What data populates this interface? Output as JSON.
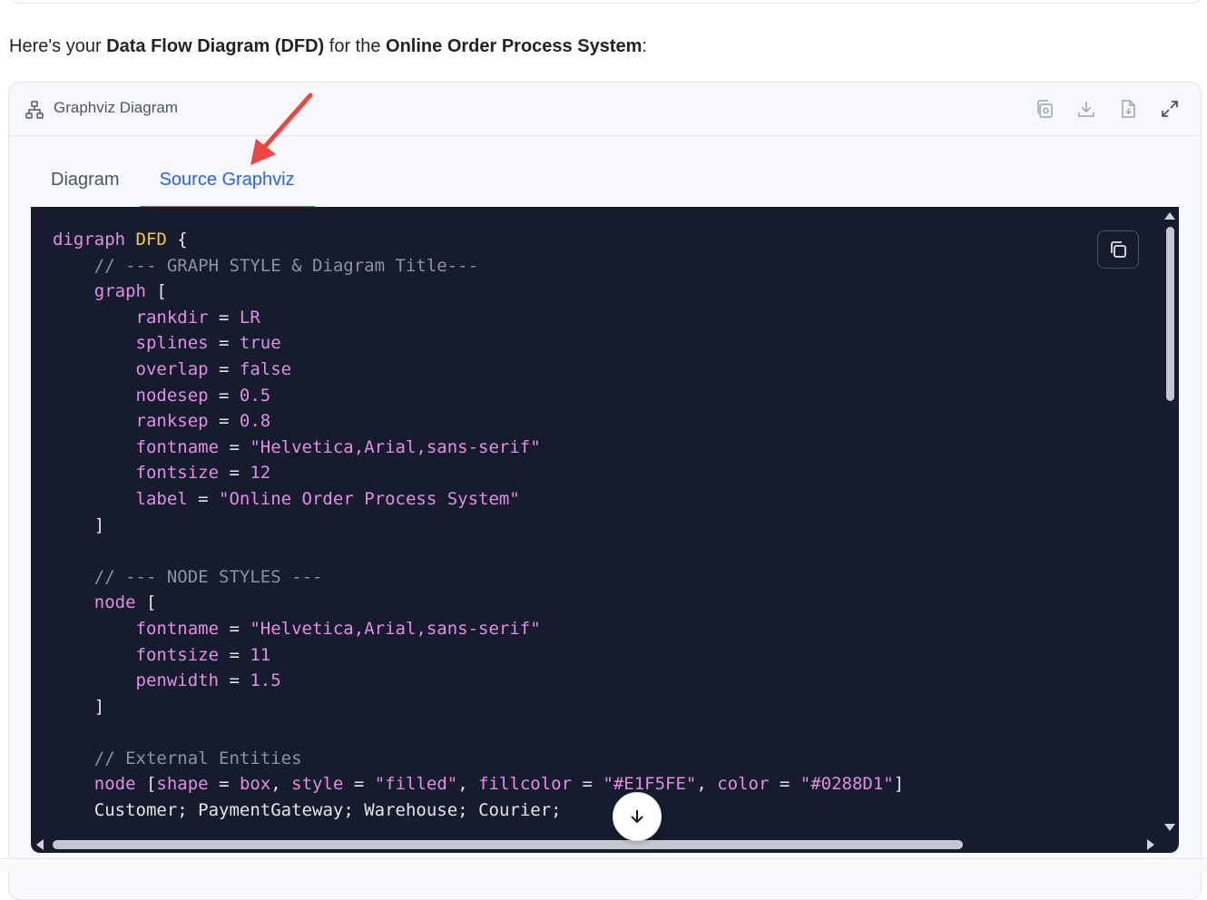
{
  "intro": {
    "prefix": "Here's your ",
    "bold1": "Data Flow Diagram (DFD)",
    "middle": " for the ",
    "bold2": "Online Order Process System",
    "suffix": ":"
  },
  "card": {
    "title": "Graphviz Diagram",
    "header_icon": "sitemap-icon",
    "actions": [
      {
        "name": "copy-image-icon"
      },
      {
        "name": "download-icon"
      },
      {
        "name": "download-file-icon"
      },
      {
        "name": "expand-icon"
      }
    ]
  },
  "tabs": [
    {
      "label": "Diagram",
      "active": false
    },
    {
      "label": "Source Graphviz",
      "active": true
    }
  ],
  "code": {
    "lines": [
      "digraph DFD {",
      "    // --- GRAPH STYLE & Diagram Title---",
      "    graph [",
      "        rankdir = LR",
      "        splines = true",
      "        overlap = false",
      "        nodesep = 0.5",
      "        ranksep = 0.8",
      "        fontname = \"Helvetica,Arial,sans-serif\"",
      "        fontsize = 12",
      "        label = \"Online Order Process System\"",
      "    ]",
      "",
      "    // --- NODE STYLES ---",
      "    node [",
      "        fontname = \"Helvetica,Arial,sans-serif\"",
      "        fontsize = 11",
      "        penwidth = 1.5",
      "    ]",
      "",
      "    // External Entities",
      "    node [shape = box, style = \"filled\", fillcolor = \"#E1F5FE\", color = \"#0288D1\"]",
      "    Customer; PaymentGateway; Warehouse; Courier;"
    ]
  },
  "colors": {
    "accent": "#2563eb",
    "code_bg": "#161b2e",
    "annotation_arrow": "#ef4444"
  }
}
